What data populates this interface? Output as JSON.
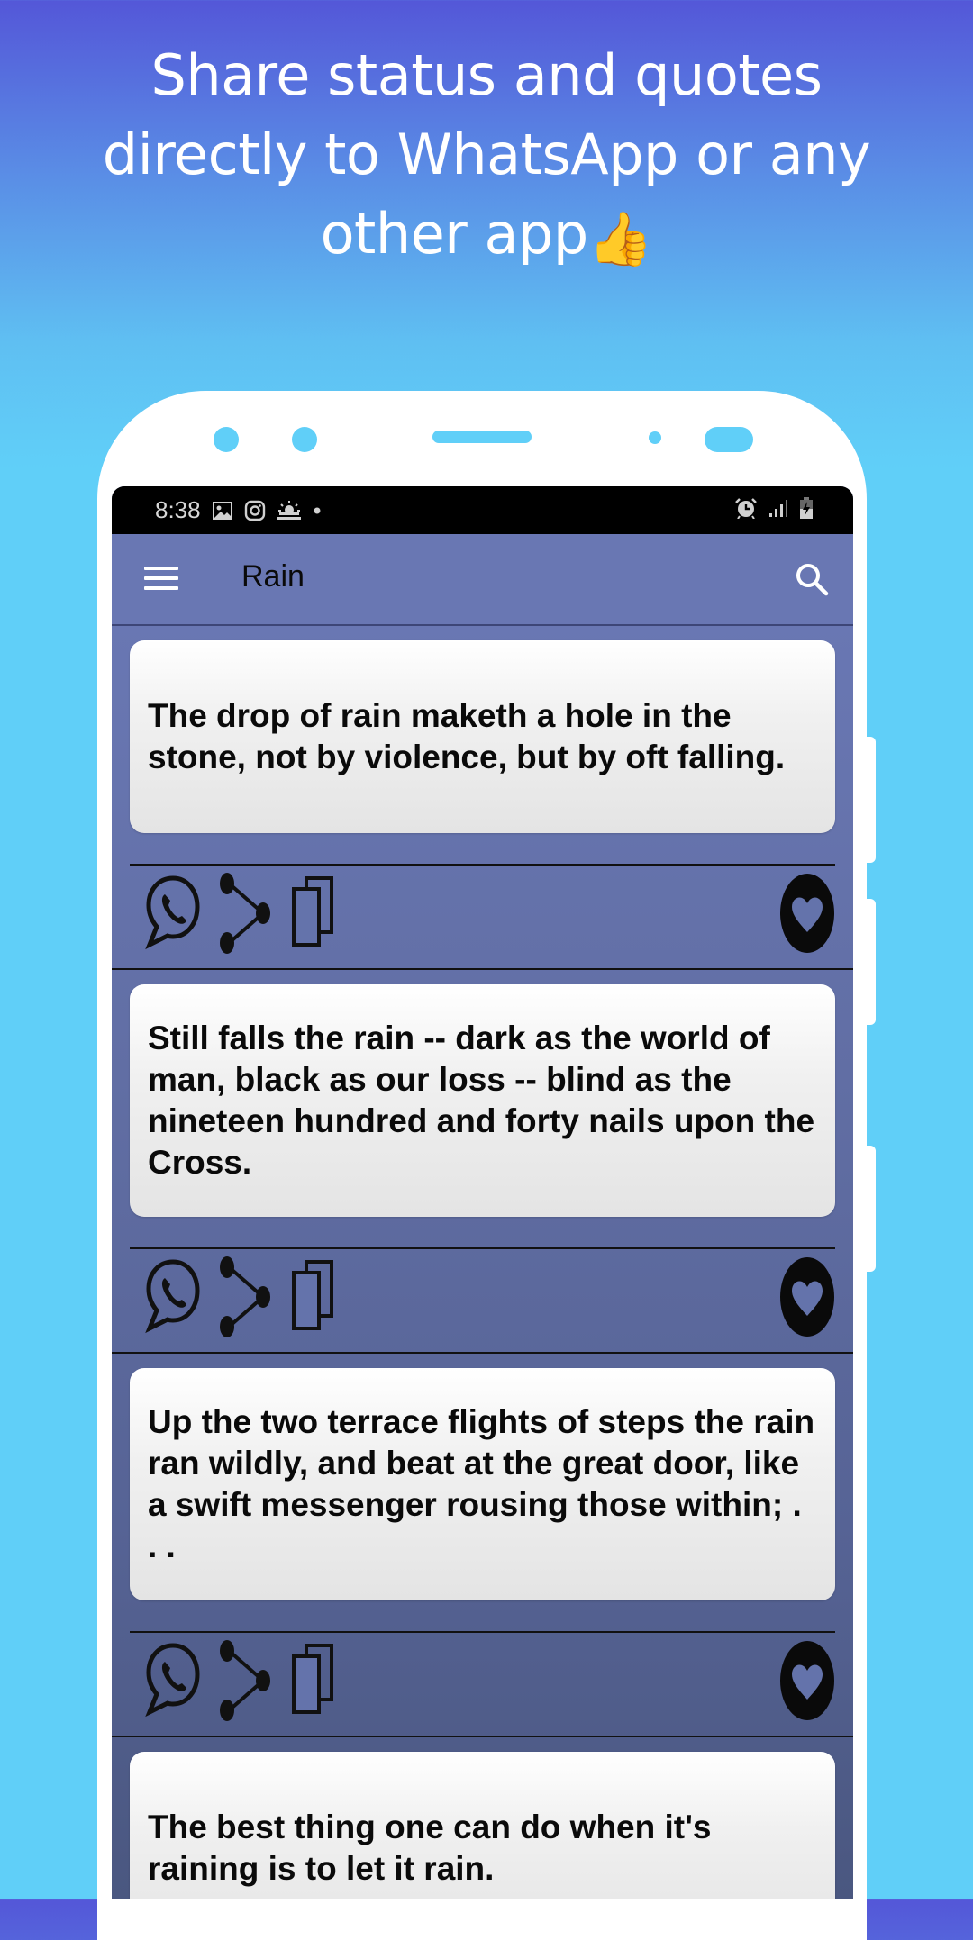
{
  "promo": {
    "headline_lines": [
      "Share status and quotes",
      "directly to WhatsApp or any",
      "other app"
    ],
    "emoji": "👍",
    "emoji_name": "thumbs-up"
  },
  "status_bar": {
    "time": "8:38",
    "left_icons": [
      "gallery-icon",
      "instagram-icon",
      "weather-icon",
      "dot-icon"
    ],
    "right_icons": [
      "alarm-icon",
      "signal-icon",
      "battery-charging-icon"
    ]
  },
  "app_bar": {
    "title": "Rain",
    "menu_icon": "hamburger-menu-icon",
    "search_icon": "search-icon"
  },
  "quotes": [
    {
      "text": "The drop of rain maketh a hole in the stone, not by violence, but by oft falling."
    },
    {
      "text": "Still falls the rain -- dark as the world of man, black as our loss -- blind as the nineteen hundred and forty nails upon the Cross."
    },
    {
      "text": "Up the two terrace flights of steps the rain ran wildly, and beat at the great door, like a swift messenger rousing those within; . . ."
    },
    {
      "text": "The best thing one can do when it's raining is to let it rain."
    }
  ],
  "quote_actions": [
    "whatsapp-share",
    "share",
    "copy",
    "favorite"
  ],
  "colors": {
    "bg_top": "#5457d8",
    "bg_bottom": "#60cff8",
    "app_bar": "#6977b3",
    "card": "#f2f2f2",
    "text": "#0a0a0a"
  }
}
